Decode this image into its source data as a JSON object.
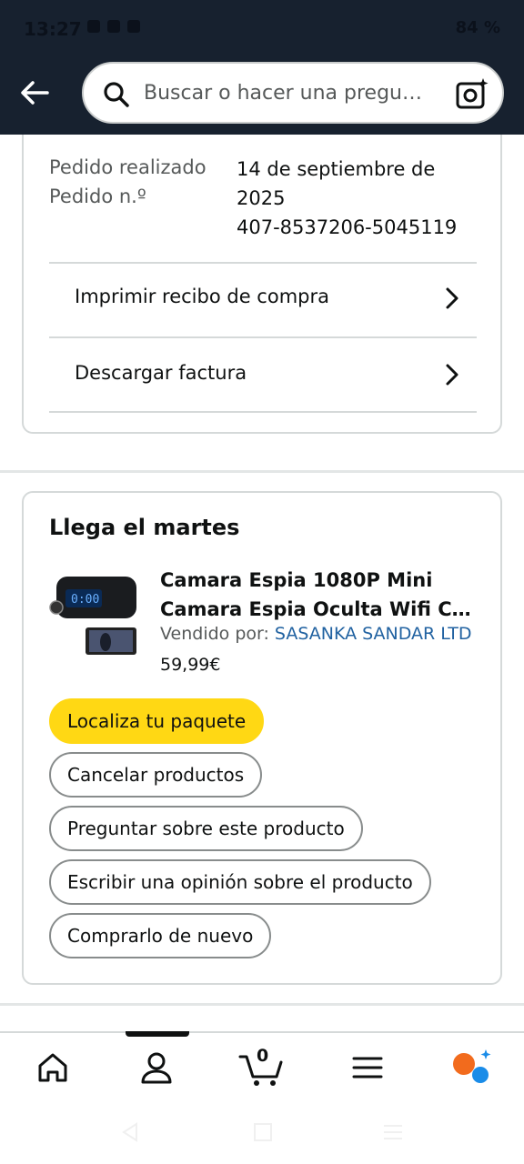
{
  "status": {
    "time": "13:27",
    "battery": "84 %"
  },
  "search": {
    "placeholder": "Buscar o hacer una pregu…"
  },
  "order": {
    "placed_label": "Pedido realizado",
    "number_label": "Pedido n.º",
    "date_line1": "14 de septiembre de",
    "date_line2": "2025",
    "number": "407-8537206-5045119"
  },
  "actions": {
    "print_receipt": "Imprimir recibo de compra",
    "download_invoice": "Descargar factura"
  },
  "shipment": {
    "heading": "Llega el martes",
    "title_line1": "Camara Espia 1080P Mini",
    "title_line2": "Camara Espia Oculta Wifi Ca...",
    "sold_by_label": "Vendido por: ",
    "seller": "SASANKA SANDAR LTD",
    "price": "59,99€",
    "thumb_clock": "0:00"
  },
  "buttons": {
    "track": "Localiza tu paquete",
    "cancel": "Cancelar productos",
    "ask": "Preguntar sobre este producto",
    "review": "Escribir una opinión sobre el producto",
    "buy_again": "Comprarlo de nuevo"
  },
  "nav": {
    "cart_count": "0"
  }
}
